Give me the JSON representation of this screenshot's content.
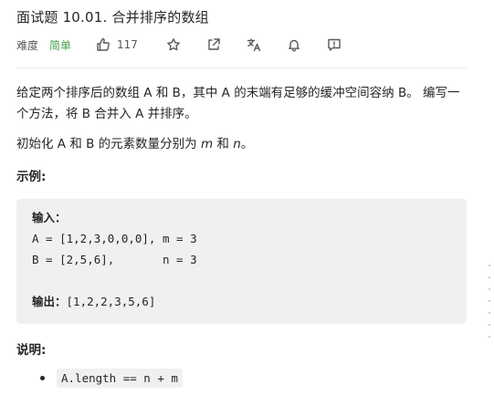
{
  "problem": {
    "title": "面试题 10.01. 合并排序的数组",
    "difficulty_label": "难度",
    "difficulty": "简单",
    "likes": "117"
  },
  "description": {
    "para1": "给定两个排序后的数组 A 和 B，其中 A 的末端有足够的缓冲空间容纳 B。 编写一个方法，将 B 合并入 A 并排序。",
    "para2_prefix": "初始化 A 和 B 的元素数量分别为 ",
    "para2_m": "m",
    "para2_mid": " 和 ",
    "para2_n": "n",
    "para2_suffix": "。",
    "example_heading": "示例:",
    "example": {
      "input_label": "输入：",
      "line1": "A = [1,2,3,0,0,0], m = 3",
      "line2": "B = [2,5,6],       n = 3",
      "output_label": "输出：",
      "output_value": "[1,2,2,3,5,6]"
    },
    "notes_heading": "说明:",
    "notes": [
      "A.length == n + m"
    ]
  },
  "colors": {
    "easy": "#43a047",
    "code_bg": "#f0f0f0",
    "text": "#262626"
  },
  "icons": [
    "thumbs-up-icon",
    "star-icon",
    "share-icon",
    "translate-icon",
    "bell-icon",
    "feedback-icon"
  ]
}
